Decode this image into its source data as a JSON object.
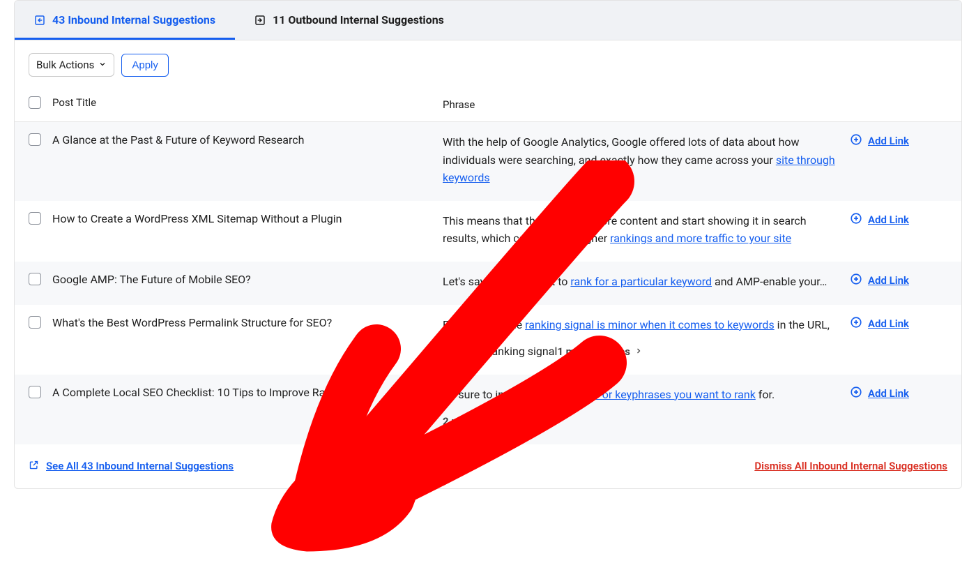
{
  "colors": {
    "primary": "#155eef",
    "danger": "#d92d20",
    "annotation": "#ff0000"
  },
  "tabs": {
    "inbound": {
      "label": "43 Inbound Internal Suggestions",
      "active": true
    },
    "outbound": {
      "label": "11 Outbound Internal Suggestions",
      "active": false
    }
  },
  "toolbar": {
    "bulk_label": "Bulk Actions",
    "apply_label": "Apply"
  },
  "headers": {
    "post_title": "Post Title",
    "phrase": "Phrase"
  },
  "action_label": "Add Link",
  "rows": [
    {
      "title": "A Glance at the Past & Future of Keyword Research",
      "phrase_pre": "With the help of Google Analytics, Google offered lots of data about how individuals were searching, and exactly how they came across your ",
      "phrase_link": "site through keywords",
      "phrase_post": "",
      "more": ""
    },
    {
      "title": "How to Create a WordPress XML Sitemap Without a Plugin",
      "phrase_pre": "This means that they can find more content and start showing it in search results, which can result in higher ",
      "phrase_link": "rankings and more traffic to your site",
      "phrase_post": "",
      "more": ""
    },
    {
      "title": "Google AMP: The Future of Mobile SEO?",
      "phrase_pre": "Let's say that you want to ",
      "phrase_link": "rank for a particular keyword",
      "phrase_post": " and AMP-enable your…",
      "more": ""
    },
    {
      "title": "What's the Best WordPress Permalink Structure for SEO?",
      "phrase_pre": "Even though the ",
      "phrase_link": "ranking signal is minor when it comes to keywords",
      "phrase_post": " in the URL, it's still a ranking signal",
      "more": "1 more phrases"
    },
    {
      "title": "A Complete Local SEO Checklist: 10 Tips to Improve Rankings",
      "phrase_pre": "Be sure to include the ",
      "phrase_link": "keywords or keyphrases you want to rank",
      "phrase_post": " for.",
      "more": "2 more phrases"
    }
  ],
  "footer": {
    "see_all": "See All 43 Inbound Internal Suggestions",
    "dismiss_all": "Dismiss All Inbound Internal Suggestions"
  }
}
